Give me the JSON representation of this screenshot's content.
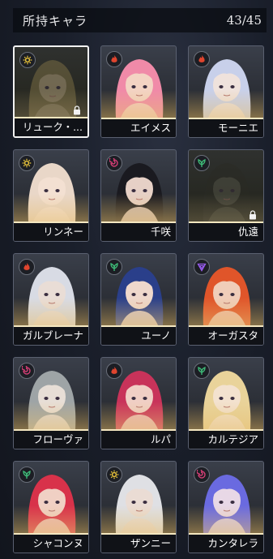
{
  "header": {
    "title": "所持キャラ",
    "count": "43/45"
  },
  "colors": {
    "sun": "#f0c93a",
    "fire": "#e0452e",
    "swirl": "#e0407a",
    "leaf": "#3fbf7a",
    "void": "#9a5cf0"
  },
  "characters": [
    {
      "name": "リューク・...",
      "element": "sun-icon",
      "hair": "#8a7a4a",
      "skin": "#c9b48a",
      "selected": true,
      "locked": true
    },
    {
      "name": "エイメス",
      "element": "fire-icon",
      "hair": "#f08aa8",
      "skin": "#f3d3c3",
      "selected": false,
      "locked": false
    },
    {
      "name": "モーニエ",
      "element": "fire-icon",
      "hair": "#c8d0ea",
      "skin": "#efe2dc",
      "selected": false,
      "locked": false
    },
    {
      "name": "リンネー",
      "element": "sun-icon",
      "hair": "#e9d7c8",
      "skin": "#f3e0d2",
      "selected": false,
      "locked": false
    },
    {
      "name": "千咲",
      "element": "swirl-icon",
      "hair": "#1a1a20",
      "skin": "#e6d0c6",
      "selected": false,
      "locked": false
    },
    {
      "name": "仇遠",
      "element": "leaf-icon",
      "hair": "#2a2b25",
      "skin": "#5a5a4c",
      "selected": false,
      "locked": true
    },
    {
      "name": "ガルブレーナ",
      "element": "fire-icon",
      "hair": "#d8dbe4",
      "skin": "#e9ddd6",
      "selected": false,
      "locked": false
    },
    {
      "name": "ユーノ",
      "element": "leaf-icon",
      "hair": "#2a3f8a",
      "skin": "#efd8cc",
      "selected": false,
      "locked": false
    },
    {
      "name": "オーガスタ",
      "element": "void-icon",
      "hair": "#e0552a",
      "skin": "#f0cdb9",
      "selected": false,
      "locked": false
    },
    {
      "name": "フローヴァ",
      "element": "swirl-icon",
      "hair": "#9ea4a6",
      "skin": "#e7ded6",
      "selected": false,
      "locked": false
    },
    {
      "name": "ルパ",
      "element": "fire-icon",
      "hair": "#c8335a",
      "skin": "#f0cfc5",
      "selected": false,
      "locked": false
    },
    {
      "name": "カルテジア",
      "element": "leaf-icon",
      "hair": "#e9d39a",
      "skin": "#f3e2cf",
      "selected": false,
      "locked": false
    },
    {
      "name": "シャコンヌ",
      "element": "leaf-icon",
      "hair": "#d8324a",
      "skin": "#f0d0c4",
      "selected": false,
      "locked": false
    },
    {
      "name": "ザンニー",
      "element": "sun-icon",
      "hair": "#dfe0e4",
      "skin": "#eadcd4",
      "selected": false,
      "locked": false
    },
    {
      "name": "カンタレラ",
      "element": "swirl-icon",
      "hair": "#6a6ae0",
      "skin": "#e8d8e6",
      "selected": false,
      "locked": false
    }
  ]
}
